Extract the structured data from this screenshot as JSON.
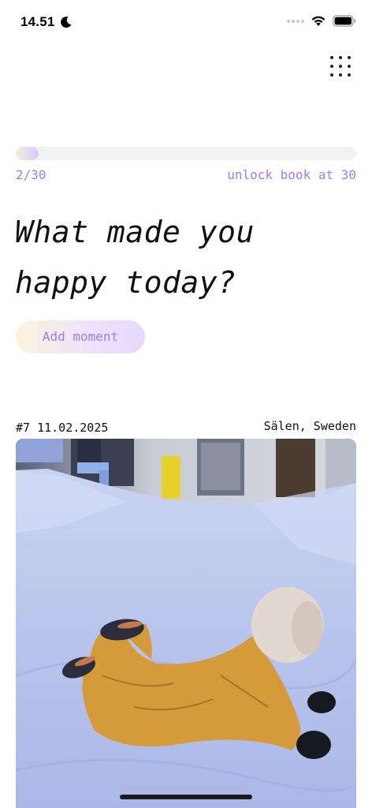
{
  "status_bar": {
    "time": "14.51",
    "icons": [
      "moon-icon",
      "signal-dots-icon",
      "wifi-icon",
      "battery-icon"
    ]
  },
  "header": {
    "menu_icon": "grid-dots-icon"
  },
  "progress": {
    "count_label": "2/30",
    "current": 2,
    "total": 30,
    "note": "unlock book at 30"
  },
  "prompt": {
    "question": "What made you happy today?"
  },
  "actions": {
    "add_moment_label": "Add moment"
  },
  "moment": {
    "number_date": "#7 11.02.2025",
    "location": "Sälen, Sweden",
    "photo_icon": "photo-child-in-snow"
  },
  "colors": {
    "accent": "#a07ce8",
    "gradient_start": "#f5ecd2",
    "gradient_end": "#d9c8fb",
    "track": "#f1f1f2",
    "text": "#111111"
  }
}
